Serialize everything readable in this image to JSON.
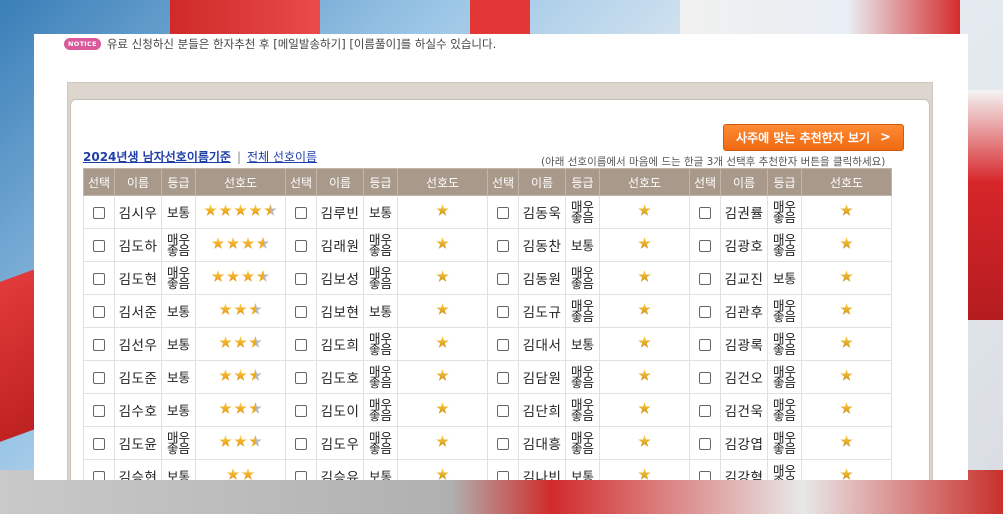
{
  "notice": {
    "badge": "NOTICE",
    "text": "유료 신청하신 분들은 한자추천 후 [메일발송하기] [이름풀이]를 하실수 있습니다."
  },
  "recommend_button": {
    "label": "사주에 맞는 추천한자 보기",
    "icon": "chevron-right-icon"
  },
  "links": {
    "primary": "2024년생 남자선호이름기준",
    "separator": "|",
    "secondary": "전체 선호이름"
  },
  "hint": "(아래 선호이름에서 마음에 드는 한글 3개 선택후 추천한자 버튼을 클릭하세요)",
  "columns": [
    "선택",
    "이름",
    "등급",
    "선호도"
  ],
  "grade_labels": {
    "normal": "보통",
    "high": "매우좋음"
  },
  "colors": {
    "header": "#a9998b",
    "button": "#f07a1e",
    "grade_normal": "#6aa13b",
    "grade_high": "#2d3fc4",
    "notice_badge": "#d9599a"
  },
  "rows": [
    [
      {
        "name": "김시우",
        "grade": "보통",
        "stars": 4.5
      },
      {
        "name": "김루빈",
        "grade": "보통",
        "stars": 1
      },
      {
        "name": "김동욱",
        "grade": "매우좋음",
        "stars": 1
      },
      {
        "name": "김권률",
        "grade": "매우좋음",
        "stars": 1
      }
    ],
    [
      {
        "name": "김도하",
        "grade": "매우좋음",
        "stars": 3.5
      },
      {
        "name": "김래원",
        "grade": "매우좋음",
        "stars": 1
      },
      {
        "name": "김동찬",
        "grade": "보통",
        "stars": 1
      },
      {
        "name": "김광호",
        "grade": "매우좋음",
        "stars": 1
      }
    ],
    [
      {
        "name": "김도현",
        "grade": "매우좋음",
        "stars": 3.5
      },
      {
        "name": "김보성",
        "grade": "매우좋음",
        "stars": 1
      },
      {
        "name": "김동원",
        "grade": "매우좋음",
        "stars": 1
      },
      {
        "name": "김교진",
        "grade": "보통",
        "stars": 1
      }
    ],
    [
      {
        "name": "김서준",
        "grade": "보통",
        "stars": 2.5
      },
      {
        "name": "김보현",
        "grade": "보통",
        "stars": 1
      },
      {
        "name": "김도규",
        "grade": "매우좋음",
        "stars": 1
      },
      {
        "name": "김관후",
        "grade": "매우좋음",
        "stars": 1
      }
    ],
    [
      {
        "name": "김선우",
        "grade": "보통",
        "stars": 2.5
      },
      {
        "name": "김도희",
        "grade": "매우좋음",
        "stars": 1
      },
      {
        "name": "김대서",
        "grade": "보통",
        "stars": 1
      },
      {
        "name": "김광록",
        "grade": "매우좋음",
        "stars": 1
      }
    ],
    [
      {
        "name": "김도준",
        "grade": "보통",
        "stars": 2.5
      },
      {
        "name": "김도호",
        "grade": "매우좋음",
        "stars": 1
      },
      {
        "name": "김담원",
        "grade": "매우좋음",
        "stars": 1
      },
      {
        "name": "김건오",
        "grade": "매우좋음",
        "stars": 1
      }
    ],
    [
      {
        "name": "김수호",
        "grade": "보통",
        "stars": 2.5
      },
      {
        "name": "김도이",
        "grade": "매우좋음",
        "stars": 1
      },
      {
        "name": "김단희",
        "grade": "매우좋음",
        "stars": 1
      },
      {
        "name": "김건욱",
        "grade": "매우좋음",
        "stars": 1
      }
    ],
    [
      {
        "name": "김도윤",
        "grade": "매우좋음",
        "stars": 2.5
      },
      {
        "name": "김도우",
        "grade": "매우좋음",
        "stars": 1
      },
      {
        "name": "김대흥",
        "grade": "매우좋음",
        "stars": 1
      },
      {
        "name": "김강엽",
        "grade": "매우좋음",
        "stars": 1
      }
    ],
    [
      {
        "name": "김승현",
        "grade": "보통",
        "stars": 2
      },
      {
        "name": "김승유",
        "grade": "보통",
        "stars": 1
      },
      {
        "name": "김나빈",
        "grade": "보통",
        "stars": 1
      },
      {
        "name": "김강혁",
        "grade": "매우좋음",
        "stars": 1
      }
    ]
  ]
}
